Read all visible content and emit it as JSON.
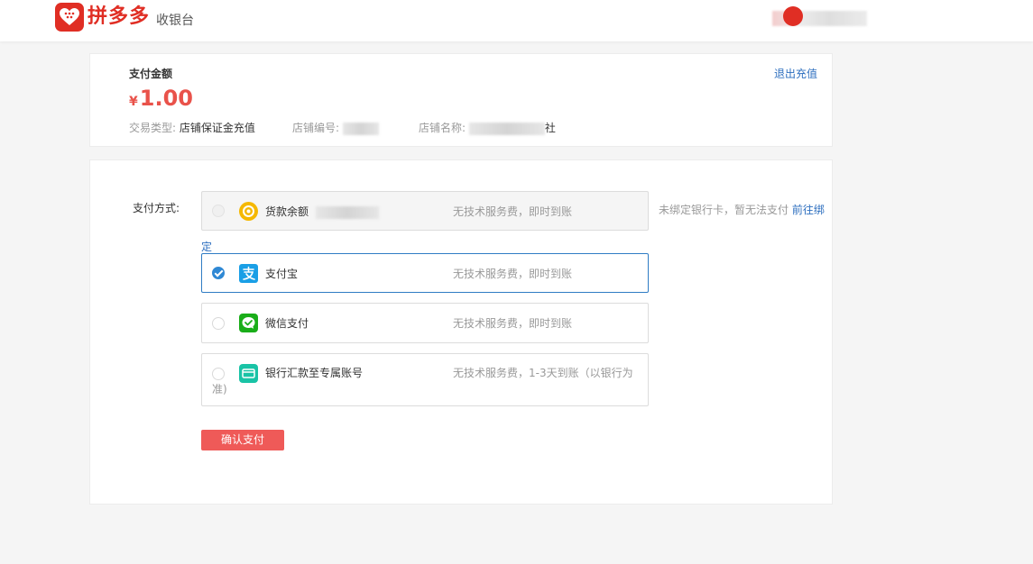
{
  "header": {
    "brand": "拼多多",
    "subtitle": "收银台",
    "logo_icon": "pinduoduo-heart-logo",
    "brand_color": "#e02e24"
  },
  "summary": {
    "amount_label": "支付金额",
    "currency": "¥",
    "amount": "1.00",
    "exit_label": "退出充值",
    "trade_type_label": "交易类型:",
    "trade_type_value": "店铺保证金充值",
    "shop_id_label": "店铺编号:",
    "shop_name_label": "店铺名称:",
    "shop_name_visible": "社",
    "amount_color": "#e9524a"
  },
  "payment": {
    "label": "支付方式:",
    "options": [
      {
        "name": "货款余额",
        "fee": "无技术服务费，即时到账",
        "icon": "balance-coin-icon",
        "disabled": true,
        "selected": false
      },
      {
        "name": "支付宝",
        "fee": "无技术服务费，即时到账",
        "icon": "alipay-icon",
        "disabled": false,
        "selected": true
      },
      {
        "name": "微信支付",
        "fee": "无技术服务费，即时到账",
        "icon": "wechat-pay-icon",
        "disabled": false,
        "selected": false
      },
      {
        "name": "银行汇款至专属账号",
        "fee": "无技术服务费，1-3天到账（以银行为准)",
        "icon": "bank-card-icon",
        "disabled": false,
        "selected": false
      }
    ],
    "unbound_note": "未绑定银行卡，暂无法支付",
    "bind_link": "前往绑定",
    "bind_link_part1": "前往绑",
    "bind_link_part2": "定",
    "confirm_label": "确认支付",
    "confirm_color": "#ef5a58",
    "link_color": "#2e6fbf"
  }
}
